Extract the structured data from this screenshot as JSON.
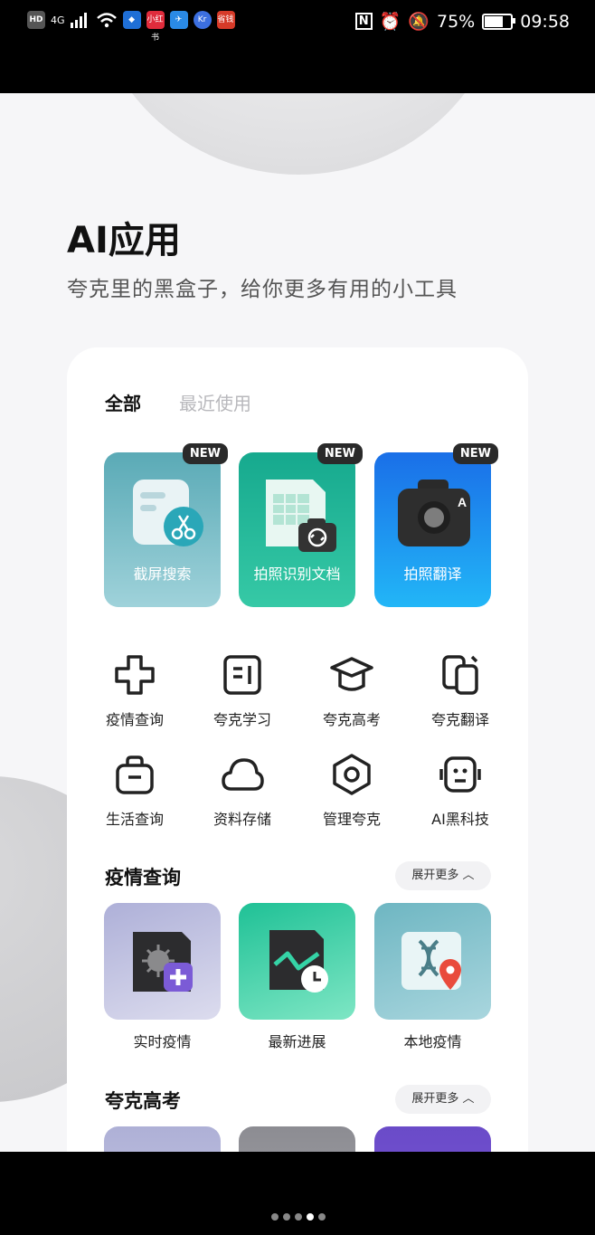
{
  "status_bar": {
    "network": "4G",
    "hd": "HD",
    "app_badges": [
      "小红书",
      "Kr",
      "省钱"
    ],
    "battery": "75%",
    "battery_level": 0.75,
    "time": "09:58"
  },
  "header": {
    "title": "AI应用",
    "subtitle": "夸克里的黑盒子，给你更多有用的小工具"
  },
  "tabs": [
    {
      "label": "全部",
      "active": true
    },
    {
      "label": "最近使用",
      "active": false
    }
  ],
  "features": [
    {
      "label": "截屏搜索",
      "badge": "NEW",
      "icon": "screenshot-scissors-icon"
    },
    {
      "label": "拍照识别文档",
      "badge": "NEW",
      "icon": "doc-scan-icon"
    },
    {
      "label": "拍照翻译",
      "badge": "NEW",
      "icon": "camera-translate-icon"
    }
  ],
  "grid": [
    {
      "label": "疫情查询",
      "icon": "medical-cross-icon"
    },
    {
      "label": "夸克学习",
      "icon": "study-icon"
    },
    {
      "label": "夸克高考",
      "icon": "graduation-cap-icon"
    },
    {
      "label": "夸克翻译",
      "icon": "translate-icon"
    },
    {
      "label": "生活查询",
      "icon": "bag-icon"
    },
    {
      "label": "资料存储",
      "icon": "cloud-icon"
    },
    {
      "label": "管理夸克",
      "icon": "settings-hex-icon"
    },
    {
      "label": "AI黑科技",
      "icon": "robot-icon"
    }
  ],
  "sections": [
    {
      "title": "疫情查询",
      "expand_label": "展开更多 ︿",
      "items": [
        {
          "label": "实时疫情",
          "icon": "virus-doc-icon"
        },
        {
          "label": "最新进展",
          "icon": "trend-doc-icon"
        },
        {
          "label": "本地疫情",
          "icon": "dna-location-icon"
        }
      ]
    },
    {
      "title": "夸克高考",
      "expand_label": "展开更多 ︿"
    }
  ],
  "page_indicator": {
    "count": 5,
    "active": 3
  },
  "colors": {
    "feature_1": "#5aaab6",
    "feature_2": "#16a98e",
    "feature_3": "#1a6fe8",
    "badge_bg": "#2a2a2a",
    "page_bg": "#f6f6f8"
  }
}
